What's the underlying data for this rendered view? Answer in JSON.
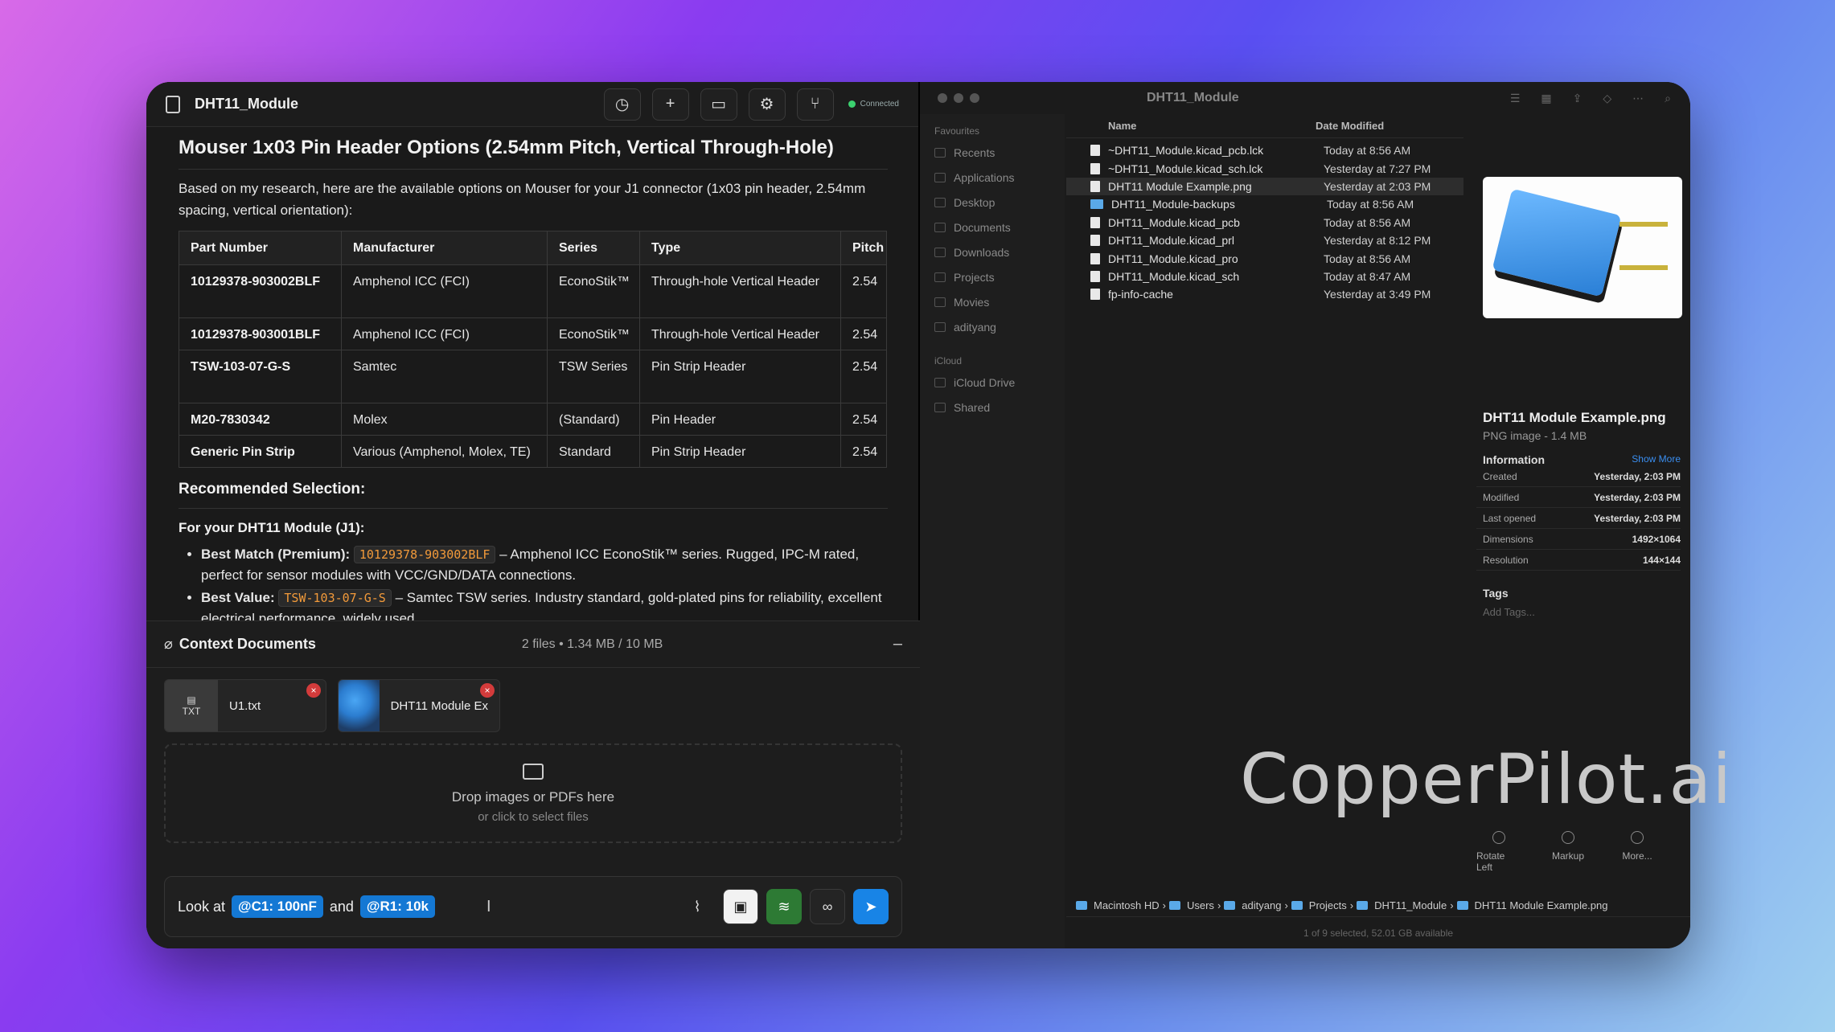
{
  "chat": {
    "title": "DHT11_Module",
    "status": "Connected",
    "heading": "Mouser 1x03 Pin Header Options (2.54mm Pitch, Vertical Through-Hole)",
    "intro": "Based on my research, here are the available options on Mouser for your J1 connector (1x03 pin header, 2.54mm spacing, vertical orientation):",
    "table": {
      "headers": [
        "Part Number",
        "Manufacturer",
        "Series",
        "Type",
        "Pitch"
      ],
      "rows": [
        [
          "10129378-903002BLF",
          "Amphenol ICC (FCI)",
          "EconoStik™",
          "Through-hole Vertical Header",
          "2.54"
        ],
        [
          "10129378-903001BLF",
          "Amphenol ICC (FCI)",
          "EconoStik™",
          "Through-hole Vertical Header",
          "2.54"
        ],
        [
          "TSW-103-07-G-S",
          "Samtec",
          "TSW Series",
          "Pin Strip Header",
          "2.54"
        ],
        [
          "M20-7830342",
          "Molex",
          "(Standard)",
          "Pin Header",
          "2.54"
        ],
        [
          "Generic Pin Strip",
          "Various (Amphenol, Molex, TE)",
          "Standard",
          "Pin Strip Header",
          "2.54"
        ]
      ]
    },
    "rec_heading": "Recommended Selection:",
    "rec_sub": "For your DHT11 Module (J1):",
    "rec1_label": "Best Match (Premium):",
    "rec1_code": "10129378-903002BLF",
    "rec1_text": "– Amphenol ICC EconoStik™ series. Rugged, IPC-M rated, perfect for sensor modules with VCC/GND/DATA connections.",
    "rec2_label": "Best Value:",
    "rec2_code": "TSW-103-07-G-S",
    "rec2_text": "– Samtec TSW series. Industry standard, gold-plated pins for reliability, excellent electrical performance, widely used."
  },
  "context": {
    "label": "Context Documents",
    "info": "2 files • 1.34 MB / 10 MB",
    "minus": "–",
    "file1_type": "TXT",
    "file1_name": "U1.txt",
    "file2_name": "DHT11 Module Ex",
    "drop_title": "Drop images or PDFs here",
    "drop_sub": "or click to select files"
  },
  "input": {
    "prefix": "Look at",
    "mention1": "@C1: 100nF",
    "and": "and",
    "mention2": "@R1: 10k"
  },
  "finder": {
    "title": "DHT11_Module",
    "favourites_label": "Favourites",
    "favourites": [
      "Recents",
      "Applications",
      "Desktop",
      "Documents",
      "Downloads",
      "Projects",
      "Movies",
      "adityang"
    ],
    "icloud_label": "iCloud",
    "icloud": [
      "iCloud Drive",
      "Shared"
    ],
    "col_name": "Name",
    "col_date": "Date Modified",
    "files": [
      {
        "name": "~DHT11_Module.kicad_pcb.lck",
        "date": "Today at 8:56 AM"
      },
      {
        "name": "~DHT11_Module.kicad_sch.lck",
        "date": "Yesterday at 7:27 PM"
      },
      {
        "name": "DHT11 Module Example.png",
        "date": "Yesterday at 2:03 PM"
      },
      {
        "name": "DHT11_Module-backups",
        "date": "Today at 8:56 AM"
      },
      {
        "name": "DHT11_Module.kicad_pcb",
        "date": "Today at 8:56 AM"
      },
      {
        "name": "DHT11_Module.kicad_prl",
        "date": "Yesterday at 8:12 PM"
      },
      {
        "name": "DHT11_Module.kicad_pro",
        "date": "Today at 8:56 AM"
      },
      {
        "name": "DHT11_Module.kicad_sch",
        "date": "Today at 8:47 AM"
      },
      {
        "name": "fp-info-cache",
        "date": "Yesterday at 3:49 PM"
      }
    ],
    "preview_title": "DHT11 Module Example.png",
    "preview_sub": "PNG image - 1.4 MB",
    "info_label": "Information",
    "show_more": "Show More",
    "info": [
      {
        "k": "Created",
        "v": "Yesterday, 2:03 PM"
      },
      {
        "k": "Modified",
        "v": "Yesterday, 2:03 PM"
      },
      {
        "k": "Last opened",
        "v": "Yesterday, 2:03 PM"
      },
      {
        "k": "Dimensions",
        "v": "1492×1064"
      },
      {
        "k": "Resolution",
        "v": "144×144"
      }
    ],
    "tags_label": "Tags",
    "add_tags": "Add Tags...",
    "actions": [
      "Rotate Left",
      "Markup",
      "More..."
    ],
    "path": [
      "Macintosh HD",
      "Users",
      "adityang",
      "Projects",
      "DHT11_Module",
      "DHT11 Module Example.png"
    ],
    "status": "1 of 9 selected, 52.01 GB available"
  },
  "watermark": "CopperPilot.ai"
}
